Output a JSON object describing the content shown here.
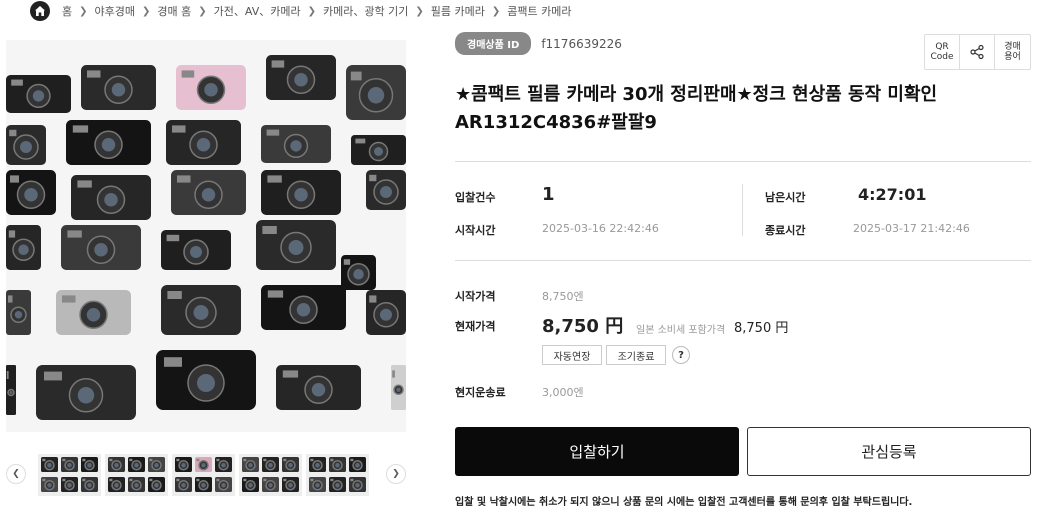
{
  "breadcrumb": [
    "홈",
    "야후경매",
    "경매 홈",
    "가전、AV、카메라",
    "카메라、광학 기기",
    "필름 카메라",
    "콤팩트 카메라"
  ],
  "item": {
    "id_label": "경매상품 ID",
    "id_value": "f1176639226",
    "title": "★콤팩트 필름 카메라 30개 정리판매★정크 현상품 동작 미확인 AR1312C4836#팔팔9"
  },
  "tools": {
    "qr": "QR\nCode",
    "share": "share-icon",
    "auction_share": "경매\n용어"
  },
  "stats": {
    "bids_label": "입찰건수",
    "bids_value": "1",
    "remaining_label": "남은시간",
    "remaining_value": "4:27:01",
    "start_label": "시작시간",
    "start_value": "2025-03-16 22:42:46",
    "end_label": "종료시간",
    "end_value": "2025-03-17 21:42:46"
  },
  "prices": {
    "start_label": "시작가격",
    "start_value": "8,750엔",
    "current_label": "현재가격",
    "current_value": "8,750 円",
    "tax_note": "일본 소비세 포함가격",
    "tax_value": "8,750 円",
    "auto_extend": "자동연장",
    "early_end": "조기종료",
    "help": "?",
    "shipping_label": "현지운송료",
    "shipping_value": "3,000엔"
  },
  "actions": {
    "bid": "입찰하기",
    "watch": "관심등록"
  },
  "notice": "입찰 및 낙찰시에는 취소가 되지 않으니 상품 문의 시에는 입찰전 고객센터를 통해 문의후 입찰 부탁드립니다.",
  "thumbnails": {
    "count": 5
  },
  "colors": {
    "badge": "#888888",
    "bid_button": "#0a0a0a",
    "text": "#222222"
  }
}
